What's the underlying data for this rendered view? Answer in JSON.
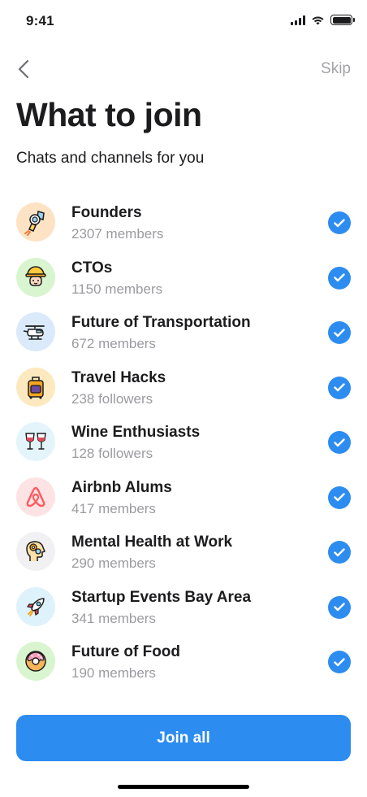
{
  "status_bar": {
    "time": "9:41"
  },
  "nav": {
    "skip_label": "Skip"
  },
  "header": {
    "title": "What to join",
    "subtitle": "Chats and channels for you"
  },
  "items": [
    {
      "name": "Founders",
      "meta": "2307 members",
      "icon": "astronaut-icon",
      "bg": "#fde2c4"
    },
    {
      "name": "CTOs",
      "meta": "1150 members",
      "icon": "engineer-icon",
      "bg": "#d9f5cf"
    },
    {
      "name": "Future of Transportation",
      "meta": "672 members",
      "icon": "helicopter-icon",
      "bg": "#dbeafb"
    },
    {
      "name": "Travel Hacks",
      "meta": "238 followers",
      "icon": "suitcase-icon",
      "bg": "#fde9bf"
    },
    {
      "name": "Wine Enthusiasts",
      "meta": "128 followers",
      "icon": "wine-glasses-icon",
      "bg": "#e3f5fb"
    },
    {
      "name": "Airbnb Alums",
      "meta": "417 members",
      "icon": "airbnb-logo-icon",
      "bg": "#fde3e4"
    },
    {
      "name": "Mental Health at Work",
      "meta": "290 members",
      "icon": "head-gears-icon",
      "bg": "#f1f1f3"
    },
    {
      "name": "Startup Events Bay Area",
      "meta": "341 members",
      "icon": "rocket-icon",
      "bg": "#def2fb"
    },
    {
      "name": "Future of Food",
      "meta": "190 members",
      "icon": "donut-icon",
      "bg": "#d9f5cf"
    }
  ],
  "footer": {
    "join_all_label": "Join all"
  },
  "colors": {
    "accent": "#2d8cf0",
    "skip": "#a3a3a8",
    "meta": "#9b9ba0"
  }
}
